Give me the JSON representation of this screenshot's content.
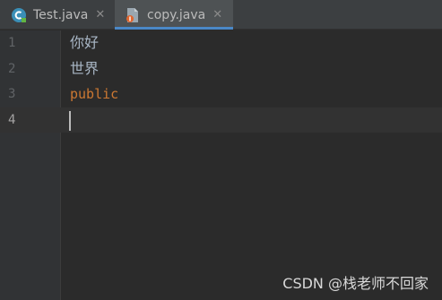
{
  "tabs": [
    {
      "label": "Test.java",
      "close": "✕",
      "icon": "java-class-icon"
    },
    {
      "label": "copy.java",
      "close": "✕",
      "icon": "java-file-icon",
      "active": true
    }
  ],
  "line_numbers": [
    "1",
    "2",
    "3",
    "4"
  ],
  "code_lines": [
    "你好",
    "世界",
    "public",
    ""
  ],
  "watermark": "CSDN @栈老师不回家",
  "colors": {
    "background": "#2b2b2b",
    "gutter": "#313335",
    "keyword": "#cc7832",
    "text": "#a9b7c6",
    "active_tab_underline": "#4a88c7"
  }
}
